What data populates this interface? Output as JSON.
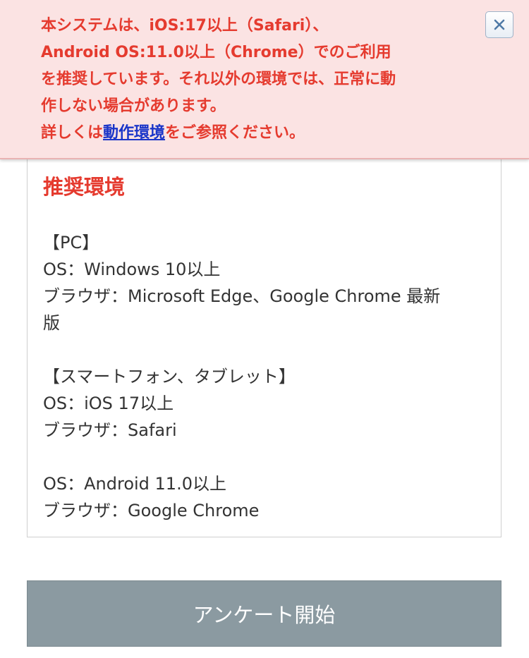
{
  "warning": {
    "lines": [
      "本システムは、iOS:17以上（Safari）、",
      "Android OS:11.0以上（Chrome）でのご利用",
      "を推奨しています。それ以外の環境では、正常に動",
      "作しない場合があります。"
    ],
    "last_prefix": "詳しくは",
    "link_text": "動作環境",
    "last_suffix": "をご参照ください。",
    "close_icon": "close-icon",
    "colors": {
      "text": "#e53b2f",
      "background": "#fbe3e3",
      "link": "#1a35c9"
    }
  },
  "environment": {
    "title": "推奨環境",
    "pc": {
      "heading": "【PC】",
      "os": "OS：Windows 10以上",
      "browser_line1": "ブラウザ：Microsoft Edge、Google Chrome 最新",
      "browser_line2": "版"
    },
    "mobile": {
      "heading": "【スマートフォン、タブレット】",
      "ios_os": "OS：iOS 17以上",
      "ios_browser": "ブラウザ：Safari",
      "android_os": "OS：Android 11.0以上",
      "android_browser": "ブラウザ：Google Chrome"
    }
  },
  "start_button": {
    "label": "アンケート開始",
    "color": "#8b9aa1"
  }
}
